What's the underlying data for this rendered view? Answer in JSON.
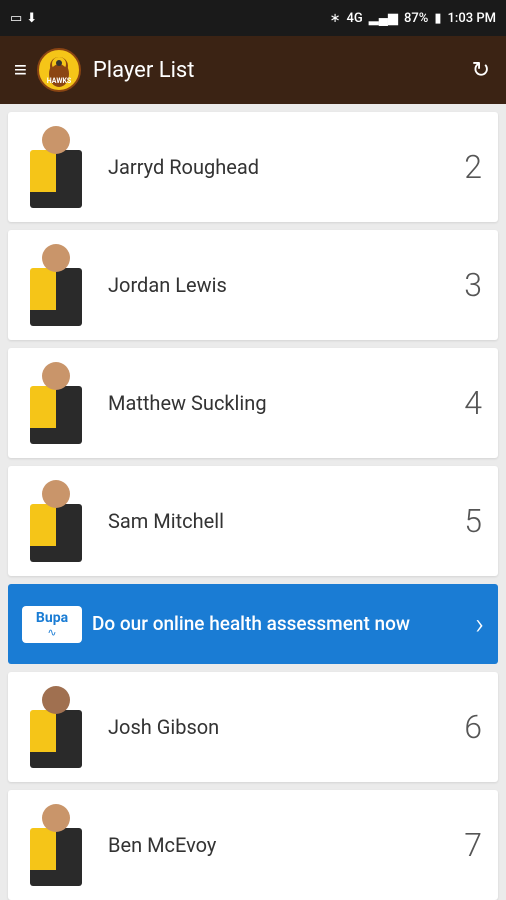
{
  "statusBar": {
    "bluetooth": "BT",
    "network": "4G",
    "battery": "87%",
    "time": "1:03 PM"
  },
  "appBar": {
    "title": "Player List",
    "refreshLabel": "↻"
  },
  "players": [
    {
      "id": 1,
      "name": "Jarryd Roughead",
      "number": "2"
    },
    {
      "id": 2,
      "name": "Jordan Lewis",
      "number": "3"
    },
    {
      "id": 3,
      "name": "Matthew Suckling",
      "number": "4"
    },
    {
      "id": 4,
      "name": "Sam Mitchell",
      "number": "5"
    },
    {
      "id": 5,
      "name": "Josh Gibson",
      "number": "6"
    },
    {
      "id": 6,
      "name": "Ben McEvoy",
      "number": "7"
    }
  ],
  "ad": {
    "brand": "Bupa",
    "wave": "∿",
    "text": "Do our online health assessment now",
    "arrow": "›"
  },
  "adInsertAfterIndex": 3
}
